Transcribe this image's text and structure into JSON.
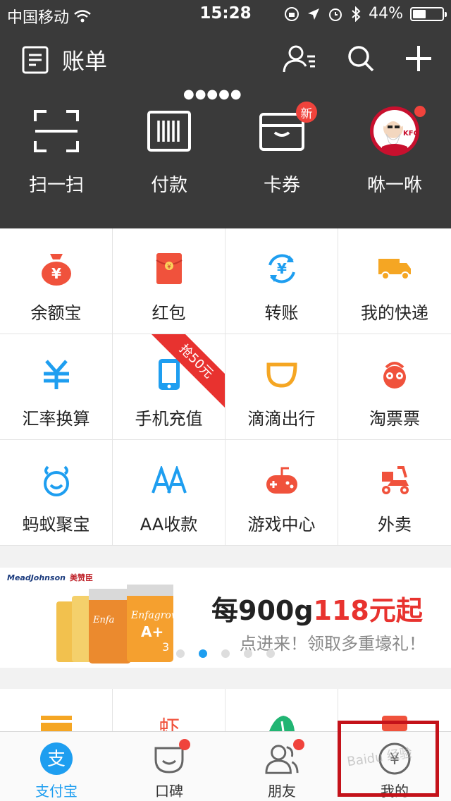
{
  "status_bar": {
    "carrier": "中国移动",
    "time": "15:28",
    "battery_percent": "44%",
    "battery_level": 0.44
  },
  "header": {
    "title": "账单"
  },
  "quick_actions": [
    {
      "label": "扫一扫",
      "icon": "scan-icon"
    },
    {
      "label": "付款",
      "icon": "barcode-icon"
    },
    {
      "label": "卡券",
      "icon": "wallet-icon",
      "badge": "新"
    },
    {
      "label": "咻一咻",
      "icon": "kfc-avatar-icon"
    }
  ],
  "grid": [
    {
      "label": "余额宝",
      "icon": "money-bag-icon",
      "color": "#f0523c"
    },
    {
      "label": "红包",
      "icon": "red-envelope-icon",
      "color": "#f0523c"
    },
    {
      "label": "转账",
      "icon": "transfer-icon",
      "color": "#1e9ef0"
    },
    {
      "label": "我的快递",
      "icon": "truck-icon",
      "color": "#f5a623"
    },
    {
      "label": "汇率换算",
      "icon": "yen-exchange-icon",
      "color": "#1e9ef0"
    },
    {
      "label": "手机充值",
      "icon": "phone-icon",
      "color": "#1e9ef0",
      "ribbon": "抢50元"
    },
    {
      "label": "滴滴出行",
      "icon": "didi-icon",
      "color": "#f5a623"
    },
    {
      "label": "淘票票",
      "icon": "ticket-face-icon",
      "color": "#f0523c"
    },
    {
      "label": "蚂蚁聚宝",
      "icon": "ant-fortune-icon",
      "color": "#1e9ef0"
    },
    {
      "label": "AA收款",
      "icon": "aa-icon",
      "color": "#1e9ef0"
    },
    {
      "label": "游戏中心",
      "icon": "gamepad-icon",
      "color": "#f0523c"
    },
    {
      "label": "外卖",
      "icon": "scooter-icon",
      "color": "#f0523c"
    }
  ],
  "banner": {
    "brand": "MeadJohnson",
    "brand_cn": "美赞臣",
    "headline_black": "每900g",
    "headline_red": "118元起",
    "sub": "点进来！领取多重壕礼！",
    "page_index": 1,
    "page_count": 5
  },
  "tabbar": [
    {
      "label": "支付宝",
      "icon": "alipay-icon",
      "active": true
    },
    {
      "label": "口碑",
      "icon": "koubei-icon",
      "dot": true
    },
    {
      "label": "朋友",
      "icon": "friends-icon",
      "dot": true
    },
    {
      "label": "我的",
      "icon": "mine-yen-icon"
    }
  ],
  "colors": {
    "header_bg": "#3a3a3a",
    "accent": "#1e9ef0",
    "red": "#f0433c",
    "highlight_box": "#c4121a"
  }
}
